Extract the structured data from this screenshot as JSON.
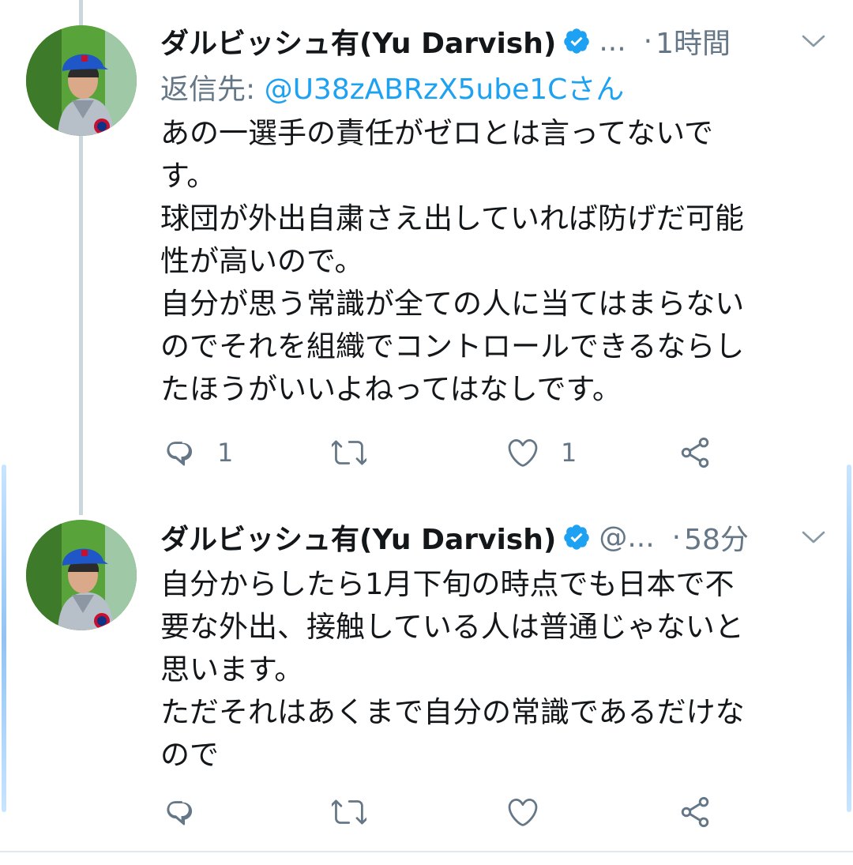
{
  "colors": {
    "text": "#14171a",
    "secondary": "#657786",
    "link": "#1da1f2",
    "verified": "#1da1f2",
    "thread_line": "#ccd6dd"
  },
  "tweets": [
    {
      "display_name": "ダルビッシュ有(Yu Darvish)",
      "handle": "...",
      "dot": "·",
      "time": "1時間",
      "reply_prefix": "返信先: ",
      "reply_mention": "@U38zABRzX5ube1Cさん",
      "lines": [
        "あの一選手の責任がゼロとは言ってないで",
        "す。",
        "球団が外出自粛さえ出していれば防げだ可能",
        "性が高いので。",
        "自分が思う常識が全ての人に当てはまらない",
        "のでそれを組織でコントロールできるならし",
        "たほうがいいよねってはなしです。"
      ],
      "reply_count": "1",
      "like_count": "1",
      "icons": [
        "reply-icon",
        "retweet-icon",
        "heart-icon",
        "share-icon"
      ]
    },
    {
      "display_name": "ダルビッシュ有(Yu Darvish)",
      "handle": "@...",
      "dot": "·",
      "time": "58分",
      "lines": [
        "自分からしたら1月下旬の時点でも日本で不",
        "要な外出、接触している人は普通じゃないと",
        "思います。",
        "ただそれはあくまで自分の常識であるだけな",
        "ので"
      ],
      "icons": [
        "reply-icon",
        "retweet-icon",
        "heart-icon",
        "share-icon"
      ]
    }
  ]
}
